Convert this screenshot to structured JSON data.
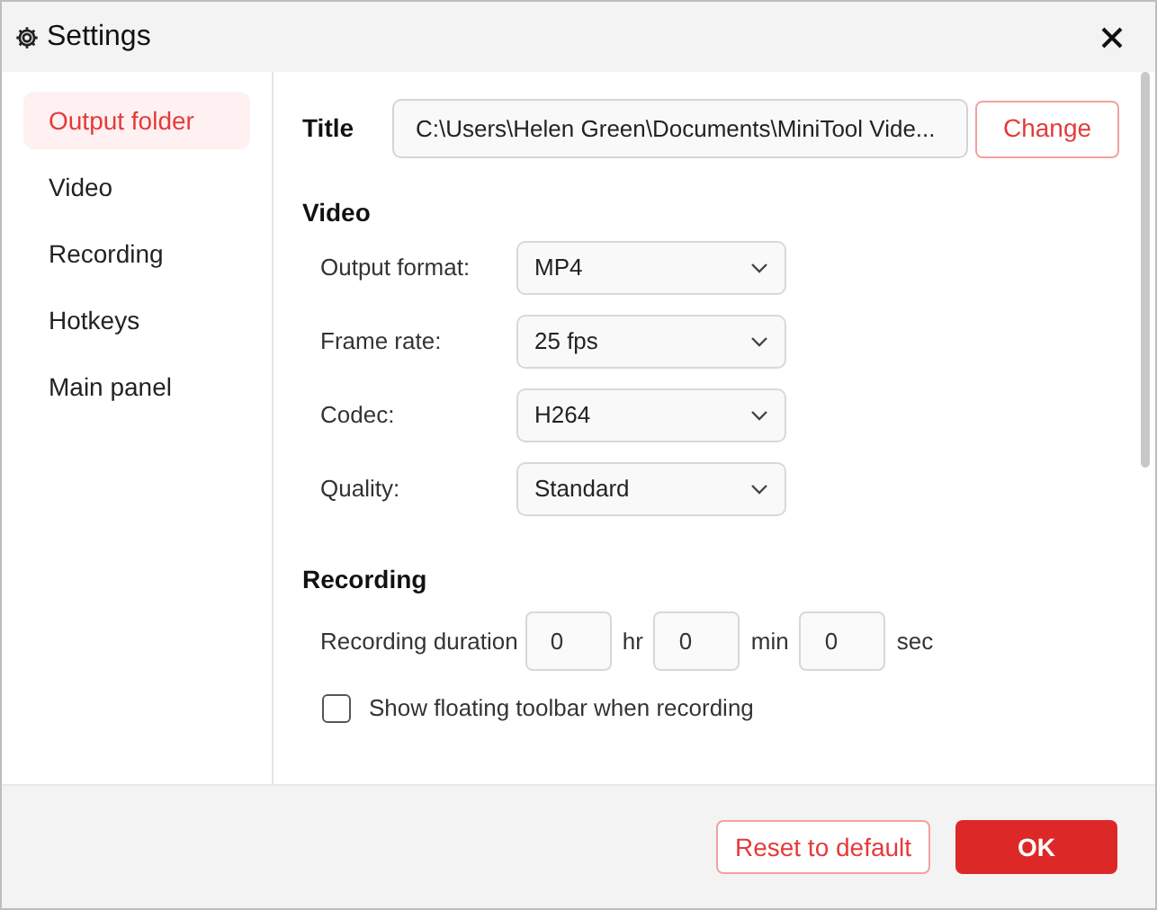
{
  "window": {
    "title": "Settings"
  },
  "sidebar": {
    "items": [
      {
        "label": "Output folder",
        "selected": true
      },
      {
        "label": "Video",
        "selected": false
      },
      {
        "label": "Recording",
        "selected": false
      },
      {
        "label": "Hotkeys",
        "selected": false
      },
      {
        "label": "Main panel",
        "selected": false
      }
    ]
  },
  "output_folder": {
    "label": "Title",
    "path": "C:\\Users\\Helen Green\\Documents\\MiniTool Vide...",
    "button": "Change"
  },
  "video": {
    "heading": "Video",
    "fields": [
      {
        "label": "Output format:",
        "value": "MP4"
      },
      {
        "label": "Frame rate:",
        "value": "25 fps"
      },
      {
        "label": "Codec:",
        "value": "H264"
      },
      {
        "label": "Quality:",
        "value": "Standard"
      }
    ]
  },
  "recording": {
    "heading": "Recording",
    "duration_label": "Recording duration",
    "duration": [
      {
        "value": "0",
        "unit": "hr"
      },
      {
        "value": "0",
        "unit": "min"
      },
      {
        "value": "0",
        "unit": "sec"
      }
    ],
    "floating_toolbar": {
      "label": "Show floating toolbar when recording",
      "checked": false
    }
  },
  "buttons": [
    {
      "label": "Reset to default",
      "kind": "secondary"
    },
    {
      "label": "OK",
      "kind": "primary"
    }
  ]
}
